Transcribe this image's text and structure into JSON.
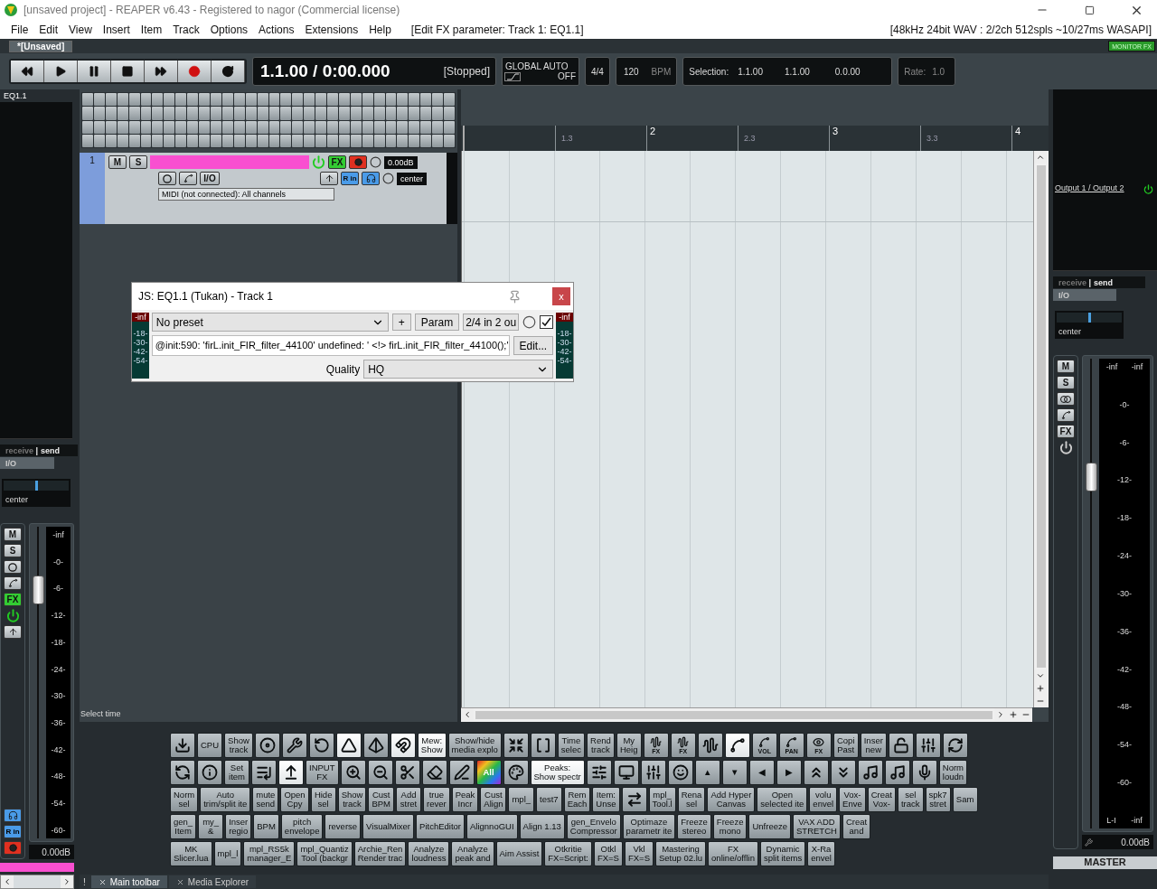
{
  "window": {
    "title": "[unsaved project] - REAPER v6.43 - Registered to nagor (Commercial license)"
  },
  "menu_bar": {
    "items": [
      "File",
      "Edit",
      "View",
      "Insert",
      "Item",
      "Track",
      "Options",
      "Actions",
      "Extensions",
      "Help"
    ],
    "fx_param": "[Edit FX parameter: Track 1: EQ1.1]",
    "status": "[48kHz 24bit WAV : 2/2ch 512spls ~10/27ms WASAPI]"
  },
  "project_tabs": [
    {
      "label": "*[Unsaved]",
      "selected": true
    }
  ],
  "monitor_fx": {
    "label": "MONITOR FX",
    "on": true
  },
  "transport": {
    "buttons": [
      {
        "kind": "rewind"
      },
      {
        "kind": "play"
      },
      {
        "kind": "pause"
      },
      {
        "kind": "stop"
      },
      {
        "kind": "forward"
      },
      {
        "kind": "record"
      },
      {
        "kind": "repeat"
      }
    ],
    "time": "1.1.00 / 0:00.000",
    "state": "[Stopped]",
    "global_auto": {
      "label": "GLOBAL AUTO",
      "value": "OFF"
    },
    "time_signature": "4/4",
    "tempo": "120",
    "tempo_unit": "BPM",
    "selection": {
      "label": "Selection:",
      "start": "1.1.00",
      "end": "1.1.00",
      "length": "0.0.00"
    },
    "rate": {
      "label": "Rate:",
      "value": "1.0"
    }
  },
  "mixer_strip": {
    "name": "EQ1.1",
    "receive": "receive",
    "separator": "|",
    "send": "send",
    "io": "I/O",
    "pan": {
      "label": "center",
      "level": 0.5
    },
    "mute": "M",
    "solo": "S",
    "fx": "FX",
    "fx_on": true,
    "input": "R in",
    "armed": true,
    "peak": "-inf",
    "scale": [
      "-0-",
      "-6-",
      "-12-",
      "-18-",
      "-24-",
      "-30-",
      "-36-",
      "-42-",
      "-48-",
      "-54-",
      "-60-"
    ],
    "fader": {
      "level": 0.8
    },
    "volume": "0.00dB"
  },
  "tcp": {
    "tracks": [
      {
        "number": "1",
        "selected": true,
        "color": "#f94fd0",
        "mute": "M",
        "solo": "S",
        "fx": "FX",
        "fx_on": true,
        "armed": true,
        "volume": "0.00dB",
        "io": "I/O",
        "input": "R in",
        "pan": "center",
        "midi_input": "MIDI (not connected): All channels"
      }
    ],
    "status": "Select time"
  },
  "ruler": [
    {
      "label": "1.3",
      "major": false
    },
    {
      "label": "2",
      "major": true
    },
    {
      "label": "2.3",
      "major": false
    },
    {
      "label": "3",
      "major": true
    },
    {
      "label": "3.3",
      "major": false
    },
    {
      "label": "4",
      "major": true
    }
  ],
  "fx_window": {
    "title": "JS: EQ1.1 (Tukan) - Track 1",
    "close": "x",
    "preset": "No preset",
    "add": "+",
    "param": "Param",
    "io": "2/4 in 2 ou",
    "enabled": true,
    "error": "@init:590: 'firL.init_FIR_filter_44100' undefined: ' <!> firL.init_FIR_filter_44100();'",
    "edit": "Edit...",
    "quality_label": "Quality",
    "quality": "HQ",
    "input_meter": {
      "peak": "-inf",
      "scale": [
        "-18-",
        "-30-",
        "-42-",
        "-54-"
      ]
    },
    "output_meter": {
      "peak": "-inf",
      "scale": [
        "-18-",
        "-30-",
        "-42-",
        "-54-"
      ]
    }
  },
  "toolbar": {
    "rows": [
      {
        "buttons": [
          {
            "kind": "icon",
            "on": false
          },
          {
            "kind": "text",
            "label": "CPU",
            "on": false
          },
          {
            "kind": "text",
            "label": "Show\ntrack",
            "on": false
          },
          {
            "kind": "icon",
            "on": false
          },
          {
            "kind": "icon",
            "on": false
          },
          {
            "kind": "icon",
            "on": false
          },
          {
            "kind": "icon",
            "on": true
          },
          {
            "kind": "icon",
            "on": false
          },
          {
            "kind": "icon",
            "on": true
          },
          {
            "kind": "text",
            "label": "Mew:\nShow",
            "on": true
          },
          {
            "kind": "text",
            "label": "Show/hide\nmedia explo",
            "on": false
          },
          {
            "kind": "icon",
            "on": false
          },
          {
            "kind": "icon",
            "on": false
          },
          {
            "kind": "text",
            "label": "Time\nselec",
            "on": false
          },
          {
            "kind": "text",
            "label": "Rend\ntrack",
            "on": false
          },
          {
            "kind": "text",
            "label": "My\nHeig",
            "on": false
          },
          {
            "kind": "icon",
            "label": "FX",
            "on": false
          },
          {
            "kind": "icon",
            "label": "FX",
            "on": false
          },
          {
            "kind": "icon",
            "on": false
          },
          {
            "kind": "icon",
            "on": true
          },
          {
            "kind": "icon",
            "label": "VOL",
            "on": false
          },
          {
            "kind": "icon",
            "label": "PAN",
            "on": false
          },
          {
            "kind": "icon",
            "label": "FX",
            "on": false
          },
          {
            "kind": "text",
            "label": "Copi\nPast",
            "on": false
          },
          {
            "kind": "text",
            "label": "Inser\nnew",
            "on": false
          },
          {
            "kind": "icon",
            "on": false
          },
          {
            "kind": "icon",
            "on": false
          },
          {
            "kind": "icon",
            "on": false
          }
        ]
      },
      {
        "buttons": [
          {
            "kind": "icon",
            "on": false
          },
          {
            "kind": "icon",
            "on": false
          },
          {
            "kind": "text",
            "label": "Set\nitem",
            "on": false
          },
          {
            "kind": "icon",
            "on": false
          },
          {
            "kind": "icon",
            "on": true
          },
          {
            "kind": "text",
            "label": "INPUT\nFX",
            "on": false
          },
          {
            "kind": "icon",
            "on": false
          },
          {
            "kind": "icon",
            "on": false
          },
          {
            "kind": "icon",
            "on": false
          },
          {
            "kind": "icon",
            "on": false
          },
          {
            "kind": "icon",
            "on": false
          },
          {
            "kind": "rainbow",
            "label": "All",
            "on": false
          },
          {
            "kind": "icon",
            "on": false
          },
          {
            "kind": "text",
            "label": "Peaks:\nShow spectr",
            "on": true
          },
          {
            "kind": "icon",
            "on": false
          },
          {
            "kind": "icon",
            "on": false
          },
          {
            "kind": "icon",
            "on": false
          },
          {
            "kind": "icon",
            "on": false
          },
          {
            "kind": "text",
            "label": "▲",
            "on": false
          },
          {
            "kind": "text",
            "label": "▼",
            "on": false
          },
          {
            "kind": "text",
            "label": "◀",
            "on": false
          },
          {
            "kind": "text",
            "label": "▶",
            "on": false
          },
          {
            "kind": "icon",
            "on": false
          },
          {
            "kind": "icon",
            "on": false
          },
          {
            "kind": "icon",
            "on": false
          },
          {
            "kind": "icon",
            "on": false
          },
          {
            "kind": "icon",
            "on": false
          },
          {
            "kind": "text",
            "label": "Norm\nloudn",
            "on": false
          }
        ]
      },
      {
        "buttons": [
          {
            "kind": "text",
            "label": "Norm\nsel",
            "on": false
          },
          {
            "kind": "text",
            "label": "Auto\ntrim/split ite",
            "on": false
          },
          {
            "kind": "text",
            "label": "mute\nsend",
            "on": false
          },
          {
            "kind": "text",
            "label": "Open\nCpy",
            "on": false
          },
          {
            "kind": "text",
            "label": "Hide\nsel",
            "on": false
          },
          {
            "kind": "text",
            "label": "Show\ntrack",
            "on": false
          },
          {
            "kind": "text",
            "label": "Cust\nBPM",
            "on": false
          },
          {
            "kind": "text",
            "label": "Add\nstret",
            "on": false
          },
          {
            "kind": "text",
            "label": "true\nrever",
            "on": false
          },
          {
            "kind": "text",
            "label": "Peak\nIncr",
            "on": false
          },
          {
            "kind": "text",
            "label": "Cust\nAlign",
            "on": false
          },
          {
            "kind": "text",
            "label": "mpl_",
            "on": false
          },
          {
            "kind": "text",
            "label": "test7",
            "on": false
          },
          {
            "kind": "text",
            "label": "Rem\nEach",
            "on": false
          },
          {
            "kind": "text",
            "label": "Item:\nUnse",
            "on": false
          },
          {
            "kind": "icon",
            "on": false
          },
          {
            "kind": "text",
            "label": "mpl_\nTool.l",
            "on": false
          },
          {
            "kind": "text",
            "label": "Rena\nsel",
            "on": false
          },
          {
            "kind": "text",
            "label": "Add Hyper\nCanvas",
            "on": false
          },
          {
            "kind": "text",
            "label": "Open\nselected ite",
            "on": false
          },
          {
            "kind": "text",
            "label": "volu\nenvel",
            "on": false
          },
          {
            "kind": "text",
            "label": "Vox-\nEnve",
            "on": false
          },
          {
            "kind": "text",
            "label": "Creat\nVox-",
            "on": false
          },
          {
            "kind": "text",
            "label": "sel\ntrack",
            "on": false
          },
          {
            "kind": "text",
            "label": "spk7\nstret",
            "on": false
          },
          {
            "kind": "text",
            "label": "Sam",
            "on": false
          }
        ]
      },
      {
        "buttons": [
          {
            "kind": "text",
            "label": "gen_\nItem",
            "on": false
          },
          {
            "kind": "text",
            "label": "my_\n&",
            "on": false
          },
          {
            "kind": "text",
            "label": "Inser\nregio",
            "on": false
          },
          {
            "kind": "text",
            "label": "BPM",
            "on": false
          },
          {
            "kind": "text",
            "label": "pitch\nenvelope",
            "on": false
          },
          {
            "kind": "text",
            "label": "reverse",
            "on": false
          },
          {
            "kind": "text",
            "label": "VisualMixer",
            "on": false
          },
          {
            "kind": "text",
            "label": "PitchEditor",
            "on": false
          },
          {
            "kind": "text",
            "label": "AlignnoGUI",
            "on": false
          },
          {
            "kind": "text",
            "label": "Align 1.13",
            "on": false
          },
          {
            "kind": "text",
            "label": "gen_Envelo\nCompressor",
            "on": false
          },
          {
            "kind": "text",
            "label": "Optimaze\nparametr ite",
            "on": false
          },
          {
            "kind": "text",
            "label": "Freeze\nstereo",
            "on": false
          },
          {
            "kind": "text",
            "label": "Freeze\nmono",
            "on": false
          },
          {
            "kind": "text",
            "label": "Unfreeze",
            "on": false
          },
          {
            "kind": "text",
            "label": "VAX ADD\nSTRETCH",
            "on": false
          },
          {
            "kind": "text",
            "label": "Creat\nand",
            "on": false
          }
        ]
      },
      {
        "buttons": [
          {
            "kind": "text",
            "label": "MK\nSlicer.lua",
            "on": false
          },
          {
            "kind": "text",
            "label": "mpl_l",
            "on": false
          },
          {
            "kind": "text",
            "label": "mpl_RS5k\nmanager_E",
            "on": false
          },
          {
            "kind": "text",
            "label": "mpl_Quantiz\nTool (backgr",
            "on": false
          },
          {
            "kind": "text",
            "label": "Archie_Ren\nRender trac",
            "on": false
          },
          {
            "kind": "text",
            "label": "Analyze\nloudness",
            "on": false
          },
          {
            "kind": "text",
            "label": "Analyze\npeak and",
            "on": false
          },
          {
            "kind": "text",
            "label": "Aim Assist",
            "on": false
          },
          {
            "kind": "text",
            "label": "Otkritie\nFX=Script:",
            "on": false
          },
          {
            "kind": "text",
            "label": "Otkl\nFX=S",
            "on": false
          },
          {
            "kind": "text",
            "label": "Vkl\nFX=S",
            "on": false
          },
          {
            "kind": "text",
            "label": "Mastering\nSetup 02.lu",
            "on": false
          },
          {
            "kind": "text",
            "label": "FX\nonline/offlin",
            "on": false
          },
          {
            "kind": "text",
            "label": "Dynamic\nsplit items",
            "on": false
          },
          {
            "kind": "text",
            "label": "X-Ra\nenvel",
            "on": false
          }
        ]
      }
    ]
  },
  "bottom_tabs": {
    "alert": "!",
    "tabs": [
      {
        "label": "Main toolbar",
        "selected": true
      },
      {
        "label": "Media Explorer",
        "selected": false
      }
    ]
  },
  "master": {
    "output": "Output 1 / Output 2",
    "receive": "receive",
    "separator": "|",
    "send": "send",
    "io": "I/O",
    "pan": {
      "label": "center",
      "level": 0.5
    },
    "mute": "M",
    "solo": "S",
    "fx": "FX",
    "peaks": [
      "-inf",
      "-inf"
    ],
    "scale": [
      "-0-",
      "-6-",
      "-12-",
      "-18-",
      "-24-",
      "-30-",
      "-36-",
      "-42-",
      "-48-",
      "-54-",
      "-60-"
    ],
    "channel": "L-I",
    "channel_peak": "-inf",
    "fader": {
      "level": 0.75
    },
    "volume": "0.00dB",
    "label": "MASTER"
  }
}
